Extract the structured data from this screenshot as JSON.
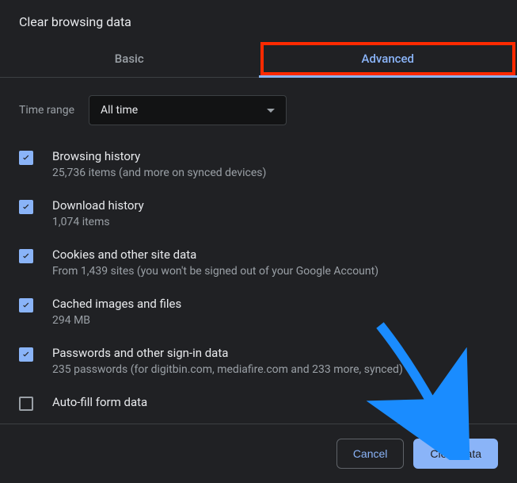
{
  "title": "Clear browsing data",
  "tabs": {
    "basic": "Basic",
    "advanced": "Advanced"
  },
  "time": {
    "label": "Time range",
    "value": "All time"
  },
  "options": [
    {
      "label": "Browsing history",
      "desc": "25,736 items (and more on synced devices)",
      "checked": true
    },
    {
      "label": "Download history",
      "desc": "1,074 items",
      "checked": true
    },
    {
      "label": "Cookies and other site data",
      "desc": "From 1,439 sites (you won't be signed out of your Google Account)",
      "checked": true
    },
    {
      "label": "Cached images and files",
      "desc": "294 MB",
      "checked": true
    },
    {
      "label": "Passwords and other sign-in data",
      "desc": "235 passwords (for digitbin.com, mediafire.com and 233 more, synced)",
      "checked": true
    },
    {
      "label": "Auto-fill form data",
      "desc": "",
      "checked": false
    }
  ],
  "buttons": {
    "cancel": "Cancel",
    "clear": "Clear data"
  },
  "colors": {
    "accent": "#8ab4f8",
    "annotation": "#1a8cff"
  }
}
